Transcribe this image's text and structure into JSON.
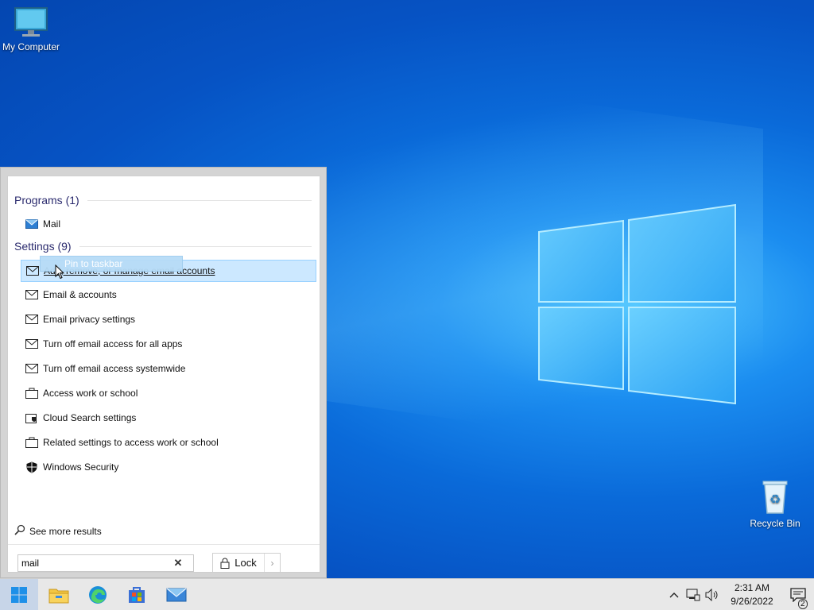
{
  "desktop": {
    "icons": [
      {
        "label": "My Computer",
        "icon": "monitor-icon"
      },
      {
        "label": "Recycle Bin",
        "icon": "recycle-bin-icon"
      }
    ]
  },
  "start_menu": {
    "programs_header": "Programs (1)",
    "programs": [
      {
        "label": "Mail",
        "icon": "mail-app-icon"
      }
    ],
    "settings_header": "Settings (9)",
    "settings": [
      {
        "label": "Add, remove, or manage email accounts",
        "icon": "envelope-icon",
        "selected": true
      },
      {
        "label": "Email & accounts",
        "icon": "envelope-icon"
      },
      {
        "label": "Email privacy settings",
        "icon": "envelope-icon"
      },
      {
        "label": "Turn off email access for all apps",
        "icon": "envelope-icon"
      },
      {
        "label": "Turn off email access systemwide",
        "icon": "envelope-icon"
      },
      {
        "label": "Access work or school",
        "icon": "briefcase-icon"
      },
      {
        "label": "Cloud Search settings",
        "icon": "cloud-search-icon"
      },
      {
        "label": "Related settings to access work or school",
        "icon": "briefcase-icon"
      },
      {
        "label": "Windows Security",
        "icon": "shield-icon"
      }
    ],
    "tooltip": "Pin to taskbar",
    "see_more": "See more results",
    "search_value": "mail",
    "lock_label": "Lock"
  },
  "taskbar": {
    "apps": [
      "windows-start-icon",
      "file-explorer-icon",
      "edge-icon",
      "store-icon",
      "mail-icon"
    ],
    "clock_time": "2:31 AM",
    "clock_date": "9/26/2022",
    "notification_count": "2"
  },
  "colors": {
    "selection_bg": "#cce8ff",
    "selection_border": "#99d1ff",
    "desktop_blue": "#0a6ad9"
  }
}
